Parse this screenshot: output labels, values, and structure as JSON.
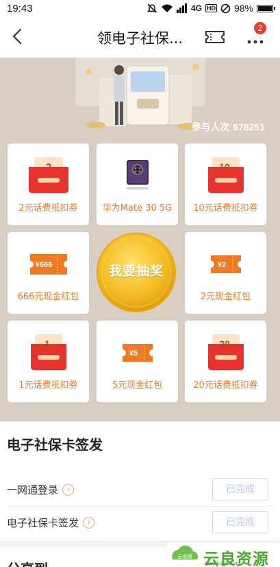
{
  "status_bar": {
    "time": "19:43",
    "network": "4G",
    "hd": "HD",
    "battery": "98%",
    "battery_level": 0.98
  },
  "nav": {
    "title": "领电子社保...",
    "notification_count": "2"
  },
  "lottery": {
    "participants_label": "参与人次",
    "participants_count": "678251",
    "draw_button_label": "我要抽奖",
    "prizes": [
      {
        "label": "2元话费抵扣券",
        "face_value": "2",
        "unit": "元",
        "icon": "phone-fee-coupon-icon"
      },
      {
        "label": "华为Mate 30 5G",
        "icon": "huawei-phone-icon"
      },
      {
        "label": "10元话费抵扣券",
        "face_value": "10",
        "unit": "元",
        "icon": "phone-fee-coupon-icon"
      },
      {
        "label": "666元现金红包",
        "face_value": "666",
        "icon": "cash-red-packet-icon"
      },
      {
        "label": "2元现金红包",
        "face_value": "2",
        "icon": "cash-red-packet-icon"
      },
      {
        "label": "1元话费抵扣券",
        "face_value": "1",
        "unit": "元",
        "icon": "phone-fee-coupon-icon"
      },
      {
        "label": "5元现金红包",
        "face_value": "5",
        "icon": "cash-red-packet-icon"
      },
      {
        "label": "20元话费抵扣券",
        "face_value": "20",
        "unit": "元",
        "icon": "phone-fee-coupon-icon"
      }
    ]
  },
  "tasks_section": {
    "title": "电子社保卡签发",
    "tasks": [
      {
        "label": "一网通登录",
        "status": "已完成"
      },
      {
        "label": "电子社保卡签发",
        "status": "已完成"
      }
    ]
  },
  "next_section": {
    "title": "分享到"
  },
  "watermark": {
    "text": "云良资源网",
    "url": "www.kubbs.com"
  },
  "colors": {
    "accent_orange": "#f07a22",
    "lottery_bg": "#d8cec1",
    "gold": "#f4bc22",
    "red": "#e8322e",
    "badge_red": "#e83b30"
  }
}
